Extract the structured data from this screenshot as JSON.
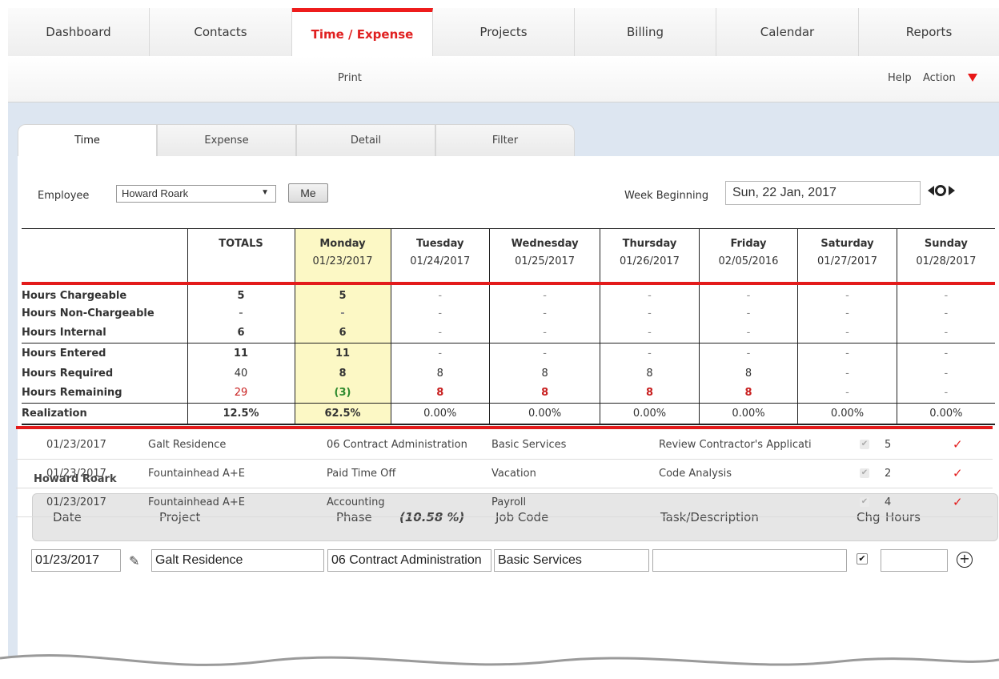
{
  "nav": {
    "tabs": [
      {
        "label": "Dashboard"
      },
      {
        "label": "Contacts"
      },
      {
        "label": "Time / Expense"
      },
      {
        "label": "Projects"
      },
      {
        "label": "Billing"
      },
      {
        "label": "Calendar"
      },
      {
        "label": "Reports"
      }
    ],
    "active": "Time / Expense",
    "accent": "#ee1c1c"
  },
  "subbar": {
    "print": "Print",
    "help": "Help",
    "action": "Action"
  },
  "subtabs": [
    {
      "label": "Time"
    },
    {
      "label": "Expense"
    },
    {
      "label": "Detail"
    },
    {
      "label": "Filter"
    }
  ],
  "employee": {
    "label": "Employee",
    "value": "Howard Roark",
    "me": "Me"
  },
  "week": {
    "label": "Week Beginning",
    "value": "Sun, 22 Jan, 2017"
  },
  "summary": {
    "totals_label": "TOTALS",
    "days": [
      {
        "name": "Monday",
        "date": "01/23/2017"
      },
      {
        "name": "Tuesday",
        "date": "01/24/2017"
      },
      {
        "name": "Wednesday",
        "date": "01/25/2017"
      },
      {
        "name": "Thursday",
        "date": "01/26/2017"
      },
      {
        "name": "Friday",
        "date": "02/05/2016"
      },
      {
        "name": "Saturday",
        "date": "01/27/2017"
      },
      {
        "name": "Sunday",
        "date": "01/28/2017"
      }
    ],
    "rows": [
      {
        "label": "Hours Chargeable",
        "total": "5",
        "values": [
          "5",
          "-",
          "-",
          "-",
          "-",
          "-",
          "-"
        ]
      },
      {
        "label": "Hours Non-Chargeable",
        "total": "-",
        "values": [
          "-",
          "-",
          "-",
          "-",
          "-",
          "-",
          "-"
        ]
      },
      {
        "label": "Hours Internal",
        "total": "6",
        "values": [
          "6",
          "-",
          "-",
          "-",
          "-",
          "-",
          "-"
        ]
      },
      {
        "label": "Hours Entered",
        "total": "11",
        "values": [
          "11",
          "-",
          "-",
          "-",
          "-",
          "-",
          "-"
        ]
      },
      {
        "label": "Hours Required",
        "total": "40",
        "values": [
          "8",
          "8",
          "8",
          "8",
          "8",
          "-",
          "-"
        ]
      },
      {
        "label": "Hours Remaining",
        "total": "29",
        "values": [
          "(3)",
          "8",
          "8",
          "8",
          "8",
          "-",
          "-"
        ]
      },
      {
        "label": "Realization",
        "total": "12.5%",
        "values": [
          "62.5%",
          "0.00%",
          "0.00%",
          "0.00%",
          "0.00%",
          "0.00%",
          "0.00%"
        ]
      }
    ]
  },
  "entries": {
    "person": "Howard Roark",
    "headers": {
      "date": "Date",
      "project": "Project",
      "phase": "Phase",
      "phase_pct": "(10.58 %)",
      "job_code": "Job Code",
      "task": "Task/Description",
      "chg": "Chg",
      "hours": "Hours"
    },
    "new_entry": {
      "date": "01/23/2017",
      "project": "Galt Residence",
      "phase": "06 Contract Administration",
      "job_code": "Basic Services",
      "task": "",
      "hours": ""
    },
    "rows": [
      {
        "date": "01/23/2017",
        "project": "Galt Residence",
        "phase": "06 Contract Administration",
        "job_code": "Basic Services",
        "task": "Review Contractor's Applicati",
        "hours": "5"
      },
      {
        "date": "01/23/2017",
        "project": "Fountainhead A+E",
        "phase": "Paid Time Off",
        "job_code": "Vacation",
        "task": "Code Analysis",
        "hours": "2"
      },
      {
        "date": "01/23/2017",
        "project": "Fountainhead A+E",
        "phase": "Accounting",
        "job_code": "Payroll",
        "task": "",
        "hours": "4"
      }
    ]
  }
}
